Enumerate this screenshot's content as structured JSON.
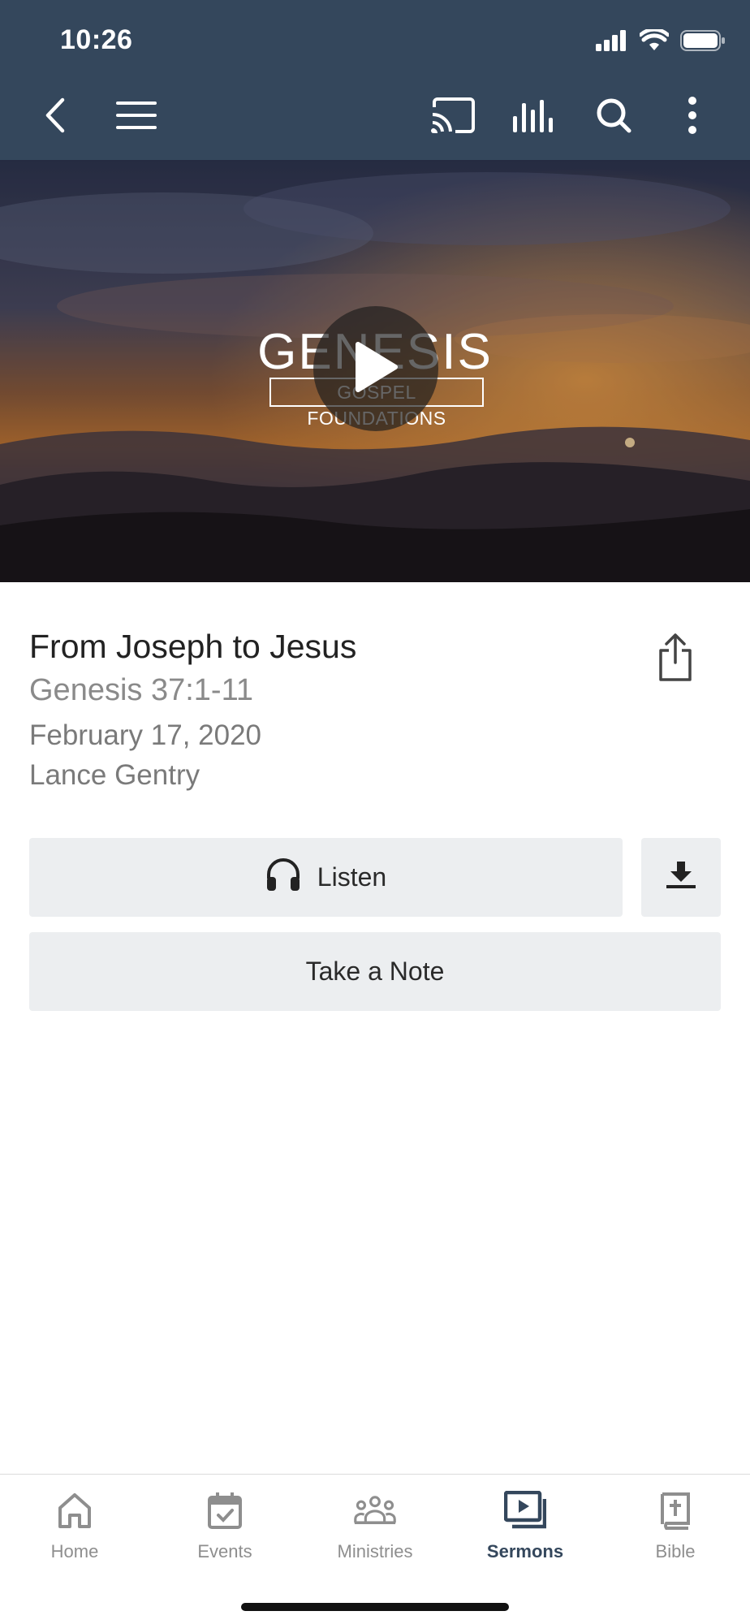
{
  "status_bar": {
    "time": "10:26"
  },
  "toolbar": {
    "icons": [
      "back-icon",
      "menu-icon",
      "cast-icon",
      "audio-bars-icon",
      "search-icon",
      "more-vertical-icon"
    ]
  },
  "hero": {
    "artwork_title": "GENESIS",
    "artwork_subtitle": "GOSPEL FOUNDATIONS"
  },
  "sermon": {
    "title": "From Joseph to Jesus",
    "scripture": "Genesis 37:1-11",
    "date": "February 17, 2020",
    "speaker": "Lance Gentry"
  },
  "actions": {
    "listen_label": "Listen",
    "note_label": "Take a Note"
  },
  "tabs": [
    {
      "label": "Home",
      "icon": "home-icon",
      "active": false
    },
    {
      "label": "Events",
      "icon": "calendar-check-icon",
      "active": false
    },
    {
      "label": "Ministries",
      "icon": "people-group-icon",
      "active": false
    },
    {
      "label": "Sermons",
      "icon": "video-library-icon",
      "active": true
    },
    {
      "label": "Bible",
      "icon": "bible-icon",
      "active": false
    }
  ],
  "colors": {
    "header": "#34475c",
    "button_bg": "#eceef0",
    "active_tab": "#34475c",
    "inactive_tab": "#8e8e8e"
  }
}
